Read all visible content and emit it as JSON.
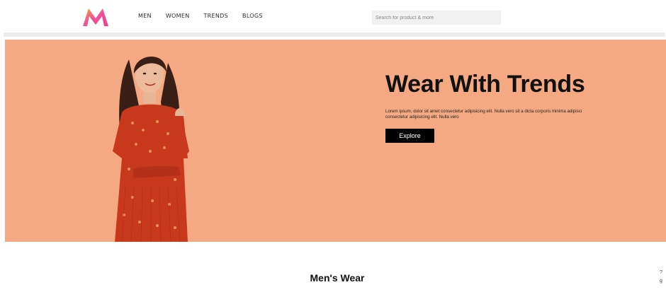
{
  "header": {
    "logo_alt": "M",
    "nav": [
      "MEN",
      "WOMEN",
      "TRENDS",
      "BLOGS"
    ],
    "search_placeholder": "Search for product & more"
  },
  "hero": {
    "title": "Wear With Trends",
    "description": "Lorem ipsum, dolor sit amet consectetur adipisicing elit. Nulla vero sit a dicta corporis minima adipisci consectetur adipisicing elit. Nulla vero",
    "button_label": "Explore",
    "background_color": "#f5a983",
    "image_icon": "woman-model-illustration"
  },
  "section": {
    "title": "Men's Wear"
  },
  "edge": {
    "text": "?\ng"
  },
  "colors": {
    "brand_pink": "#e8428a",
    "brand_orange": "#f58b24",
    "hero_bg": "#f5a983",
    "button_bg": "#000000"
  }
}
